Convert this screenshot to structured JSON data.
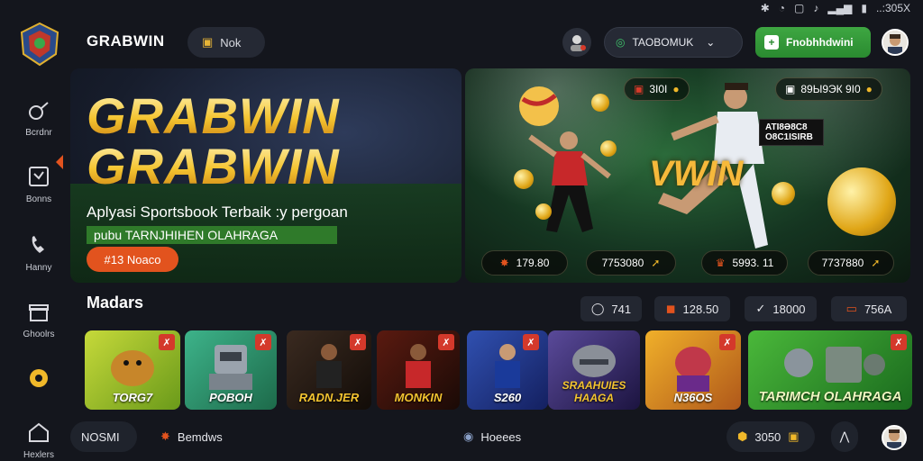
{
  "statusbar": {
    "time_text": "..:305X"
  },
  "header": {
    "brand": "GRABWIN",
    "pill_label": "Nok",
    "search_text": "TAOBOMUK",
    "green_button_label": "Fnobhhdwini"
  },
  "sidebar": {
    "items": [
      {
        "label": "Bcrdnr",
        "icon": "whistle-icon"
      },
      {
        "label": "Bonns",
        "icon": "board-icon"
      },
      {
        "label": "Hanny",
        "icon": "phone-icon"
      },
      {
        "label": "Ghoolrs",
        "icon": "gift-icon"
      },
      {
        "label": "",
        "icon": "gear-icon"
      },
      {
        "label": "Hexlers",
        "icon": "home-icon"
      }
    ]
  },
  "hero": {
    "title_line1": "GRABWIN",
    "title_line2": "GRABWIN",
    "subtitle": "Aplyasi Sportsbook Terbaik :y pergoan",
    "strip_text": "pubu TARNJHIHEN OLAHRAGA",
    "button_label": "#13 Noaco"
  },
  "promo": {
    "chip_left": "3I0I",
    "chip_right": "89Ы9ЭК 9I0",
    "label_box": "ATI8Ə8C8 O8C1ISIRB",
    "big_text": "VWIN",
    "bottom_chips": [
      "179.80",
      "7753080",
      "5993. 11",
      "7737880"
    ]
  },
  "section": {
    "title": "Madars",
    "stats": [
      "741",
      "128.50",
      "18000",
      "756A"
    ]
  },
  "cards": [
    {
      "label": "TORG7",
      "bg": "#9bbd2a"
    },
    {
      "label": "POBOH",
      "bg": "#2f9a6a"
    },
    {
      "label": "RADN.JER",
      "bg": "#2a1e18"
    },
    {
      "label": "MONKIN",
      "bg": "#3a1a12"
    },
    {
      "label": "S260",
      "bg": "#273a8a"
    },
    {
      "label": "SRAAHUIES HAAGA",
      "bg": "#3a2f6a"
    },
    {
      "label": "N36OS",
      "bg": "#d08a1a"
    },
    {
      "label": "TARIMCH OLAHRAGA",
      "bg": "#3ea236"
    }
  ],
  "bottombar": {
    "left_pill": "NOSMI",
    "left_item": "Bemdws",
    "center_item": "Hoeees",
    "coin_value": "3050"
  }
}
